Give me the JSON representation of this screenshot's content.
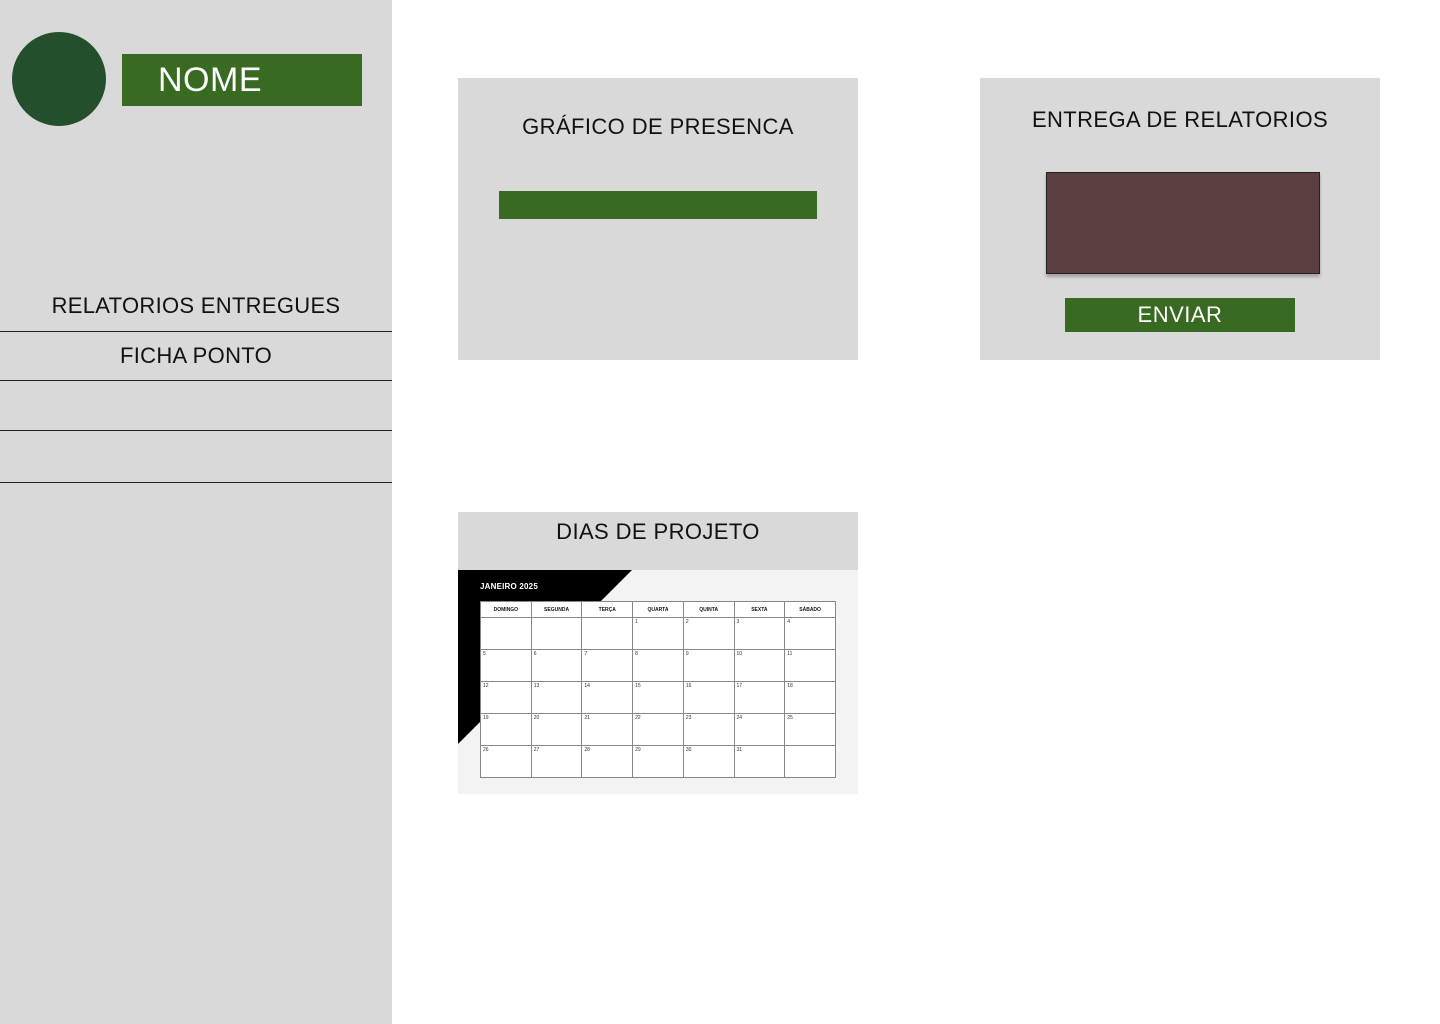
{
  "profile": {
    "name": "NOME"
  },
  "nav": {
    "items": [
      {
        "label": "RELATORIOS ENTREGUES"
      },
      {
        "label": "FICHA PONTO"
      },
      {
        "label": ""
      },
      {
        "label": ""
      }
    ]
  },
  "presence": {
    "title": "GRÁFICO DE PRESENCA",
    "fill_fraction": 1.0
  },
  "reports": {
    "title": "ENTREGA DE RELATORIOS",
    "send_label": "ENVIAR"
  },
  "project": {
    "title": "DIAS DE PROJETO",
    "calendar": {
      "month": "JANEIRO 2025",
      "weekdays": [
        "DOMINGO",
        "SEGUNDA",
        "TERÇA",
        "QUARTA",
        "QUINTA",
        "SEXTA",
        "SÁBADO"
      ],
      "weeks": [
        [
          "",
          "",
          "",
          "1",
          "2",
          "3",
          "4"
        ],
        [
          "5",
          "6",
          "7",
          "8",
          "9",
          "10",
          "11"
        ],
        [
          "12",
          "13",
          "14",
          "15",
          "16",
          "17",
          "18"
        ],
        [
          "19",
          "20",
          "21",
          "22",
          "23",
          "24",
          "25"
        ],
        [
          "26",
          "27",
          "28",
          "29",
          "30",
          "31",
          ""
        ]
      ]
    }
  },
  "colors": {
    "accent_green": "#386b21",
    "avatar_green": "#244f2d",
    "upload_box": "#5b3e3f",
    "panel_gray": "#d9d9d9"
  }
}
